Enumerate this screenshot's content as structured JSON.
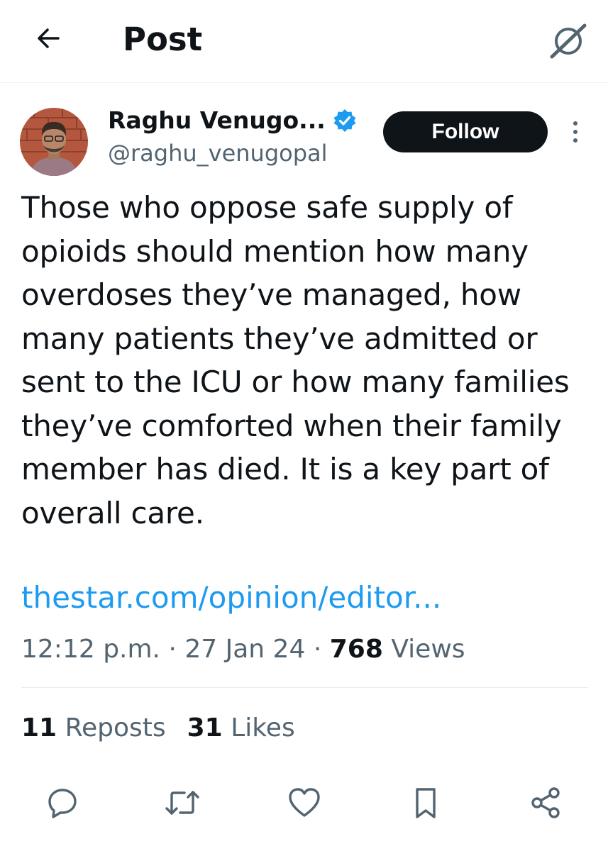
{
  "header": {
    "title": "Post",
    "back_icon": "arrow-left-icon",
    "grok_icon": "grok-icon"
  },
  "author": {
    "display_name": "Raghu Venugo...",
    "handle": "@raghu_venugopal",
    "verified_color": "#1d9bf0"
  },
  "follow_label": "Follow",
  "post": {
    "text": "Those who oppose safe supply of opioids should mention how many overdoses they’ve managed, how many patients they’ve admitted or sent to the ICU or how many families they’ve comforted when their family member has died. It is a key part of overall care.",
    "link": "thestar.com/opinion/editor...",
    "time": "12:12 p.m.",
    "date": "27 Jan 24",
    "sep": "·",
    "views_count": "768",
    "views_label": "Views"
  },
  "stats": {
    "reposts_count": "11",
    "reposts_label": "Reposts",
    "likes_count": "31",
    "likes_label": "Likes"
  },
  "actions": [
    "reply-icon",
    "repost-icon",
    "like-icon",
    "bookmark-icon",
    "share-icon"
  ],
  "colors": {
    "text": "#0f1419",
    "secondary": "#536471",
    "link": "#1d9bf0"
  }
}
